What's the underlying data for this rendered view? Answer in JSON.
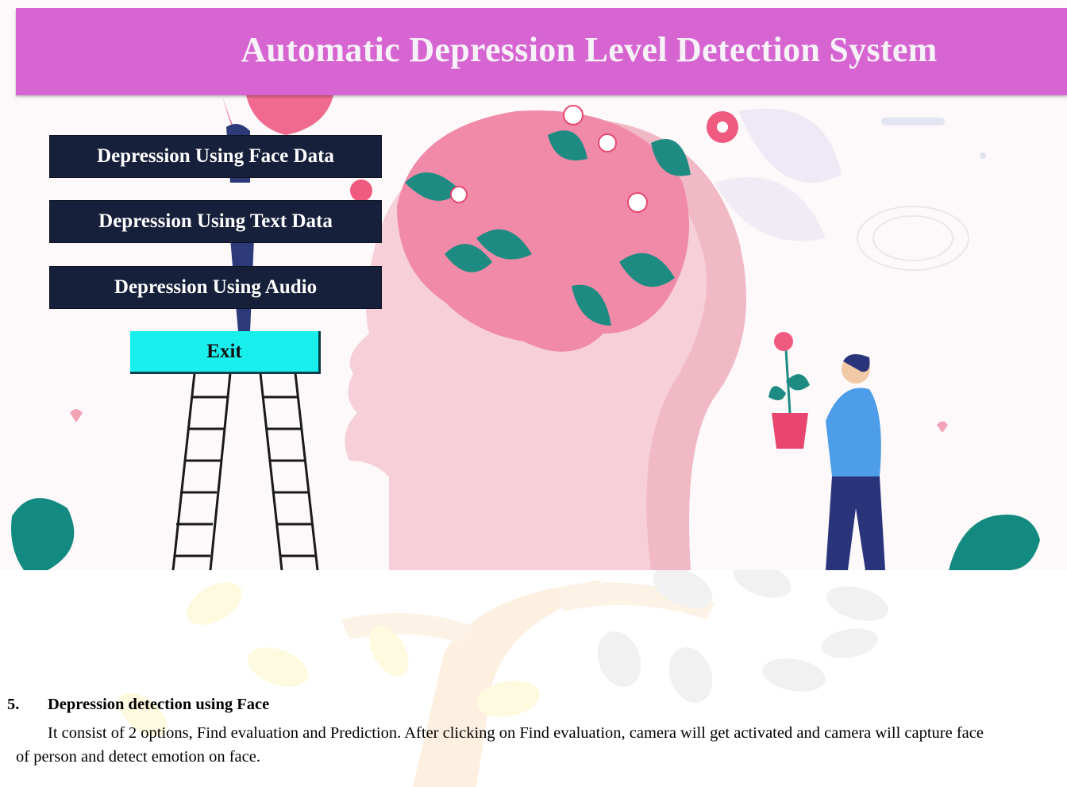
{
  "app": {
    "title": "Automatic Depression Level Detection System",
    "buttons": {
      "face": "Depression Using Face Data",
      "text": "Depression Using Text Data",
      "audio": "Depression Using Audio",
      "exit": "Exit"
    },
    "colors": {
      "title_bar": "#d665d2",
      "nav_button": "#16203a",
      "exit_button": "#19f0ee"
    }
  },
  "document": {
    "section_number": "5.",
    "section_title": "Depression detection using Face",
    "paragraph": "It consist of 2 options, Find evaluation and Prediction. After clicking on Find evaluation, camera will get activated and camera will capture face of person and detect emotion on face."
  }
}
